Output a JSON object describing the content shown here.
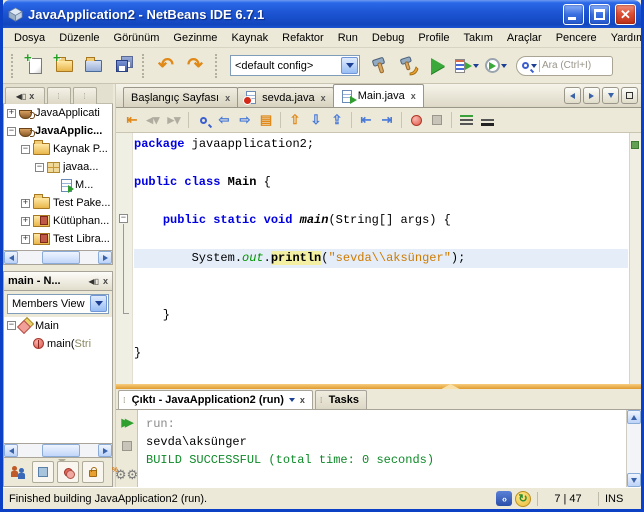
{
  "window": {
    "title": "JavaApplication2 - NetBeans IDE 6.7.1"
  },
  "menu": [
    "Dosya",
    "Düzenle",
    "Görünüm",
    "Gezinme",
    "Kaynak",
    "Refaktor",
    "Run",
    "Debug",
    "Profile",
    "Takım",
    "Araçlar",
    "Pencere",
    "Yardım"
  ],
  "toolbar": {
    "config": "<default config>",
    "search_placeholder": "Ara (Ctrl+I)"
  },
  "projects_tree": [
    {
      "label": "JavaApplicati",
      "depth": 0,
      "exp": "+",
      "icon": "project",
      "bold": false
    },
    {
      "label": "JavaApplic...",
      "depth": 0,
      "exp": "-",
      "icon": "project",
      "bold": true
    },
    {
      "label": "Kaynak P...",
      "depth": 1,
      "exp": "-",
      "icon": "folder",
      "bold": false
    },
    {
      "label": "javaa...",
      "depth": 2,
      "exp": "-",
      "icon": "package",
      "bold": false
    },
    {
      "label": "M...",
      "depth": 3,
      "exp": "",
      "icon": "javafile",
      "bold": false
    },
    {
      "label": "Test Pake...",
      "depth": 1,
      "exp": "+",
      "icon": "folder",
      "bold": false
    },
    {
      "label": "Kütüphan...",
      "depth": 1,
      "exp": "+",
      "icon": "library",
      "bold": false
    },
    {
      "label": "Test Libra...",
      "depth": 1,
      "exp": "+",
      "icon": "library",
      "bold": false
    }
  ],
  "navigator": {
    "title": "main - N...",
    "view_selector": "Members View",
    "items": [
      {
        "depth": 0,
        "exp": "-",
        "icon": "class",
        "parts": [
          {
            "t": "Main",
            "c": "pl"
          }
        ]
      },
      {
        "depth": 1,
        "exp": "",
        "icon": "method",
        "parts": [
          {
            "t": "main(",
            "c": "pl"
          },
          {
            "t": "Stri",
            "c": "param"
          }
        ]
      }
    ]
  },
  "editor": {
    "tabs": [
      {
        "label": "Başlangıç Sayfası",
        "icon": "none",
        "selected": false
      },
      {
        "label": "sevda.java",
        "icon": "class-error",
        "selected": false
      },
      {
        "label": "Main.java",
        "icon": "class-run",
        "selected": true
      }
    ],
    "code": [
      {
        "tokens": [
          {
            "t": "package",
            "c": "kw"
          },
          {
            "t": " javaapplication2;",
            "c": "pl"
          }
        ]
      },
      {
        "tokens": []
      },
      {
        "tokens": [
          {
            "t": "public class",
            "c": "kw"
          },
          {
            "t": " ",
            "c": "pl"
          },
          {
            "t": "Main",
            "c": "cls"
          },
          {
            "t": " {",
            "c": "pl"
          }
        ]
      },
      {
        "tokens": []
      },
      {
        "tokens": [
          {
            "t": "    ",
            "c": "pl"
          },
          {
            "t": "public static void",
            "c": "kw"
          },
          {
            "t": " ",
            "c": "pl"
          },
          {
            "t": "main",
            "c": "mth"
          },
          {
            "t": "(String[] args) {",
            "c": "pl"
          }
        ]
      },
      {
        "tokens": []
      },
      {
        "current": true,
        "tokens": [
          {
            "t": "        System.",
            "c": "pl"
          },
          {
            "t": "out",
            "c": "fld"
          },
          {
            "t": ".",
            "c": "pl"
          },
          {
            "t": "println",
            "c": "hl"
          },
          {
            "t": "(",
            "c": "pl"
          },
          {
            "t": "\"sevda\\\\aksünger\"",
            "c": "str"
          },
          {
            "t": ");",
            "c": "pl"
          }
        ]
      },
      {
        "tokens": []
      },
      {
        "tokens": []
      },
      {
        "tokens": [
          {
            "t": "    }",
            "c": "pl"
          }
        ]
      },
      {
        "tokens": []
      },
      {
        "tokens": [
          {
            "t": "}",
            "c": "pl"
          }
        ]
      }
    ]
  },
  "output": {
    "tab_label": "Çıktı - JavaApplication2 (run)",
    "tasks_label": "Tasks",
    "lines": [
      {
        "t": "run:",
        "c": "muted"
      },
      {
        "t": "sevda\\aksünger",
        "c": "pl"
      },
      {
        "t": "BUILD SUCCESSFUL (total time: 0 seconds)",
        "c": "ok"
      }
    ]
  },
  "statusbar": {
    "message": "Finished building JavaApplication2 (run).",
    "caret": "7 | 47",
    "mode": "INS"
  },
  "colors": {
    "keyword": "#0000e2",
    "string": "#ce7b00",
    "field_green": "#009300",
    "success_green": "#0e8a28",
    "highlight": "#f3efa3",
    "current_line": "#e4edf8",
    "titlebar_blue": "#1d55d4"
  }
}
